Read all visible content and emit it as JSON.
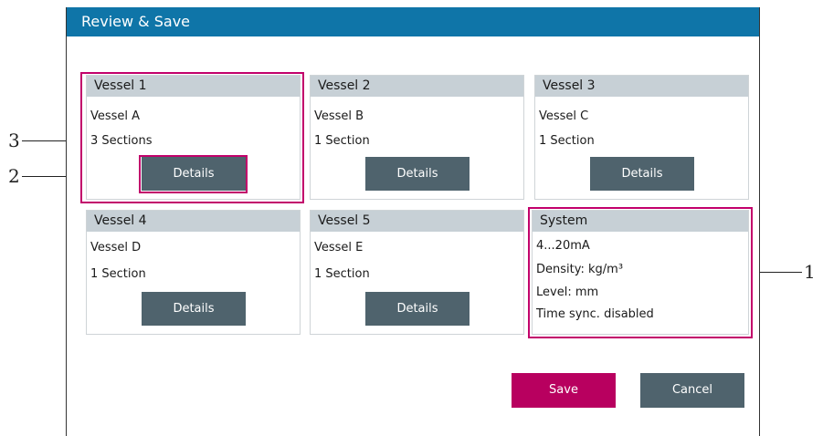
{
  "window": {
    "title": "Review & Save"
  },
  "vessels": [
    {
      "header": "Vessel 1",
      "name": "Vessel A",
      "sections": "3 Sections",
      "button": "Details"
    },
    {
      "header": "Vessel 2",
      "name": "Vessel B",
      "sections": "1 Section",
      "button": "Details"
    },
    {
      "header": "Vessel 3",
      "name": "Vessel C",
      "sections": "1 Section",
      "button": "Details"
    },
    {
      "header": "Vessel 4",
      "name": "Vessel D",
      "sections": "1 Section",
      "button": "Details"
    },
    {
      "header": "Vessel 5",
      "name": "Vessel E",
      "sections": "1 Section",
      "button": "Details"
    }
  ],
  "system": {
    "header": "System",
    "lines": [
      "4...20mA",
      "Density: kg/m³",
      "Level: mm",
      "Time sync. disabled"
    ]
  },
  "actions": {
    "save": "Save",
    "cancel": "Cancel"
  },
  "callouts": [
    "1",
    "2",
    "3"
  ],
  "colors": {
    "titlebar": "#0f75a8",
    "highlight": "#c2006b",
    "save": "#b8005f",
    "button": "#4f636d",
    "card_header": "#c7d0d6"
  }
}
